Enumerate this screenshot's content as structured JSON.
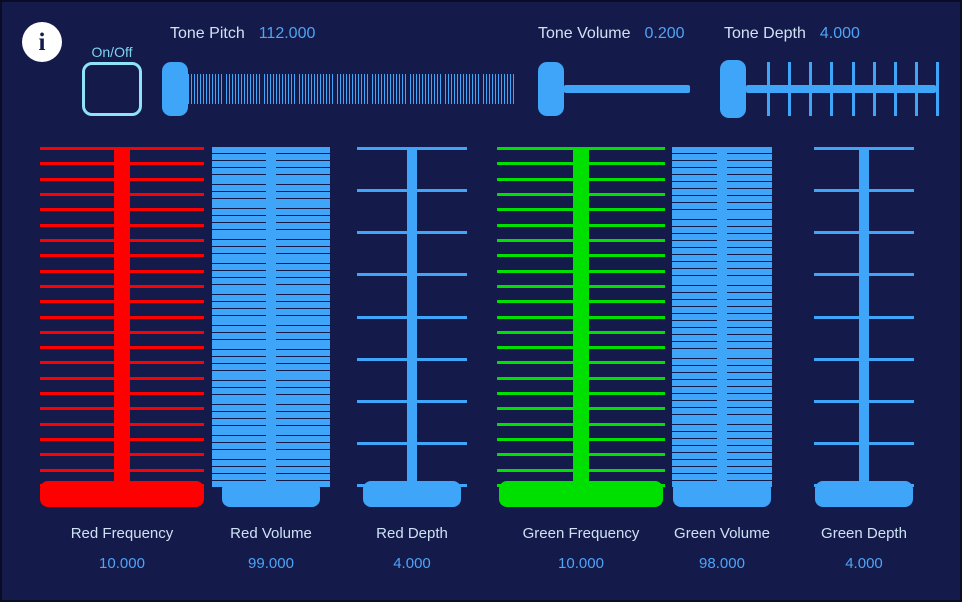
{
  "window": {
    "background_color": "#141a4a",
    "accent_blue": "#3ea5f8",
    "red": "#ff0000",
    "green": "#00e000",
    "label_color": "#cfe2f5",
    "value_color": "#4ea4f7"
  },
  "info": {
    "icon": "info-icon",
    "glyph": "i"
  },
  "onoff": {
    "label": "On/Off",
    "checked": false
  },
  "top_controls": [
    {
      "id": "tone-pitch",
      "name": "Tone Pitch",
      "value": "112.000",
      "value_number": 112.0,
      "ticks": 112,
      "style": "thick"
    },
    {
      "id": "tone-volume",
      "name": "Tone Volume",
      "value": "0.200",
      "value_number": 0.2,
      "ticks": 0,
      "style": "plain"
    },
    {
      "id": "tone-depth",
      "name": "Tone Depth",
      "value": "4.000",
      "value_number": 4.0,
      "ticks": 9,
      "style": "outer"
    }
  ],
  "vertical_controls": [
    {
      "id": "red-frequency",
      "name": "Red Frequency",
      "value": "10.000",
      "value_number": 10.0,
      "color": "#ff0000",
      "ticks": 23,
      "stem": "fat",
      "knob_width": 164
    },
    {
      "id": "red-volume",
      "name": "Red Volume",
      "value": "99.000",
      "value_number": 99.0,
      "color": "#3ea5f8",
      "ticks": 99,
      "stem": "thin",
      "knob_width": 98
    },
    {
      "id": "red-depth",
      "name": "Red Depth",
      "value": "4.000",
      "value_number": 4.0,
      "color": "#3ea5f8",
      "ticks": 9,
      "stem": "thin",
      "knob_width": 98
    },
    {
      "id": "green-frequency",
      "name": "Green Frequency",
      "value": "10.000",
      "value_number": 10.0,
      "color": "#00e000",
      "ticks": 23,
      "stem": "fat",
      "knob_width": 164
    },
    {
      "id": "green-volume",
      "name": "Green Volume",
      "value": "98.000",
      "value_number": 98.0,
      "color": "#3ea5f8",
      "ticks": 98,
      "stem": "thin",
      "knob_width": 98
    },
    {
      "id": "green-depth",
      "name": "Green Depth",
      "value": "4.000",
      "value_number": 4.0,
      "color": "#3ea5f8",
      "ticks": 9,
      "stem": "thin",
      "knob_width": 98
    }
  ]
}
